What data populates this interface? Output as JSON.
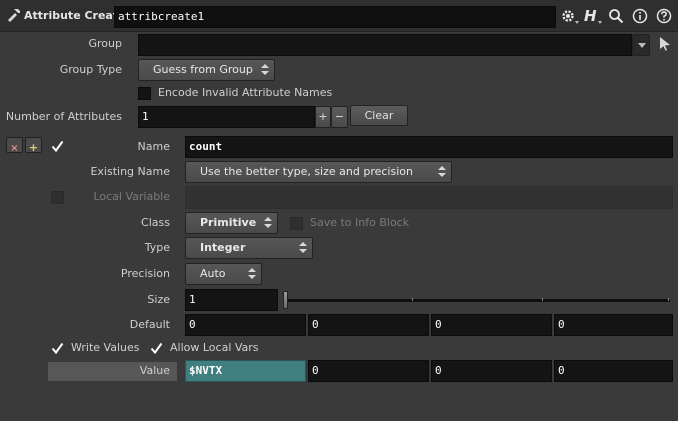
{
  "header": {
    "node_type": "Attribute Create",
    "node_name": "attribcreate1",
    "icons": [
      "attribcreate-node-icon",
      "gear-icon",
      "help-h-icon",
      "search-icon",
      "info-icon",
      "help-icon"
    ]
  },
  "group": {
    "label": "Group",
    "value": ""
  },
  "group_type": {
    "label": "Group Type",
    "value": "Guess from Group"
  },
  "encode": {
    "label": "Encode Invalid Attribute Names",
    "checked": false
  },
  "num_attributes": {
    "label": "Number of Attributes",
    "value": "1",
    "plus": "+",
    "minus": "−",
    "clear": "Clear"
  },
  "multiparm": {
    "remove": "×",
    "insert": "+"
  },
  "name": {
    "label": "Name",
    "value": "count",
    "enabled": true
  },
  "existing_name": {
    "label": "Existing Name",
    "value": "Use the better type, size and precision"
  },
  "local_variable": {
    "label": "Local Variable",
    "value": ""
  },
  "class": {
    "label": "Class",
    "value": "Primitive",
    "save_info_label": "Save to Info Block"
  },
  "type": {
    "label": "Type",
    "value": "Integer"
  },
  "precision": {
    "label": "Precision",
    "value": "Auto"
  },
  "size": {
    "label": "Size",
    "value": "1",
    "slider_fraction": 0.0
  },
  "default": {
    "label": "Default",
    "values": [
      "0",
      "0",
      "0",
      "0"
    ]
  },
  "write_values": {
    "label": "Write Values",
    "checked": true
  },
  "allow_local_vars": {
    "label": "Allow Local Vars",
    "checked": true
  },
  "value": {
    "label": "Value",
    "values": [
      "$NVTX",
      "0",
      "0",
      "0"
    ]
  },
  "colors": {
    "background": "#3a3a3a",
    "field": "#141414",
    "value_highlight": "#3f7f80",
    "panel_header": "#2b2b2b"
  }
}
